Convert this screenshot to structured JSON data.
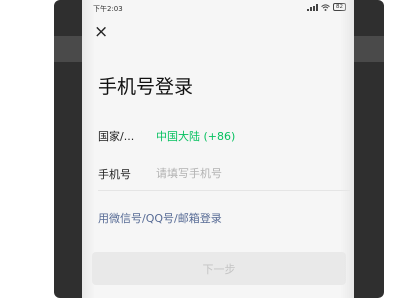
{
  "status_bar": {
    "time": "下午2:03",
    "battery": "82"
  },
  "icons": {
    "close": "close-icon",
    "signal": "signal-icon",
    "wifi": "wifi-icon",
    "battery": "battery-icon"
  },
  "title": "手机号登录",
  "country_row": {
    "label": "国家/...",
    "value": "中国大陆 (+86)"
  },
  "phone_row": {
    "label": "手机号",
    "value": "",
    "placeholder": "请填写手机号"
  },
  "alt_login": "用微信号/QQ号/邮箱登录",
  "next_button": "下一步",
  "colors": {
    "accent_green": "#07c160",
    "link_blue": "#576b95",
    "disabled_button_bg": "#e9e9e9",
    "disabled_button_text": "#c4c4c4"
  }
}
